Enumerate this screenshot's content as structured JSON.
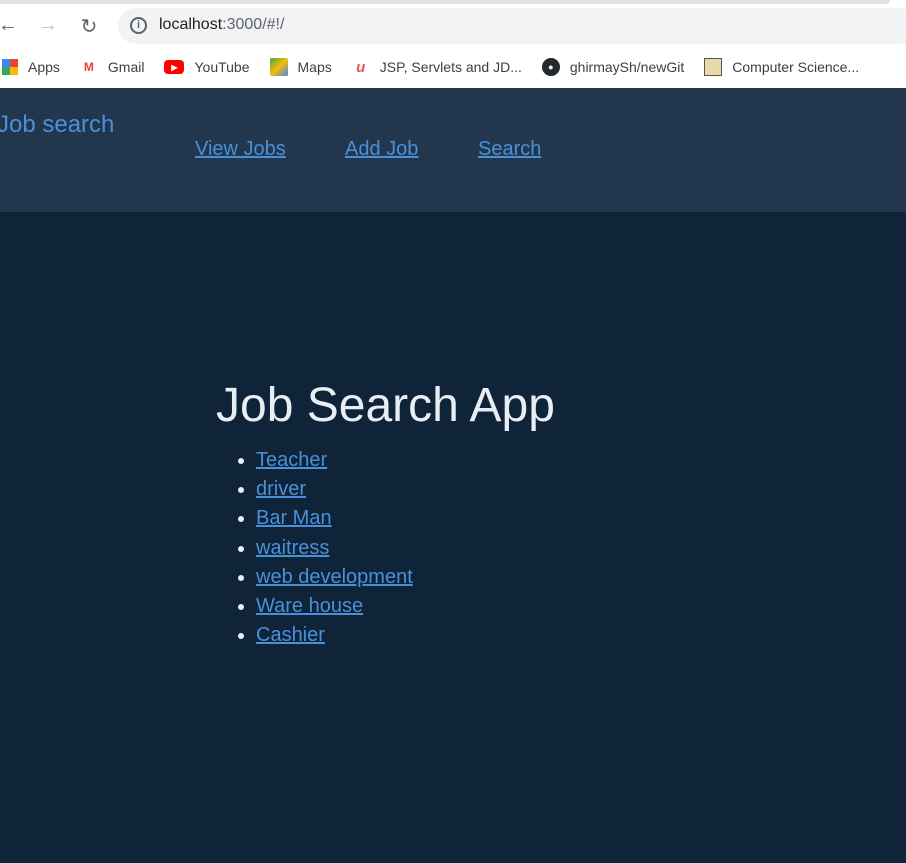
{
  "browser": {
    "url_host": "localhost",
    "url_rest": ":3000/#!/",
    "bookmarks": [
      {
        "label": "Apps",
        "icon": "apps-grid-icon"
      },
      {
        "label": "Gmail",
        "icon": "gmail-icon"
      },
      {
        "label": "YouTube",
        "icon": "youtube-icon"
      },
      {
        "label": "Maps",
        "icon": "maps-icon"
      },
      {
        "label": "JSP, Servlets and JD...",
        "icon": "udemy-icon"
      },
      {
        "label": "ghirmaySh/newGit",
        "icon": "github-icon"
      },
      {
        "label": "Computer Science...",
        "icon": "site-icon"
      }
    ]
  },
  "header": {
    "brand": "Job search",
    "nav": [
      "View Jobs",
      "Add Job",
      "Search"
    ]
  },
  "main": {
    "title": "Job Search App",
    "jobs": [
      "Teacher",
      "driver",
      "Bar Man",
      "waitress",
      "web development",
      "Ware house",
      "Cashier"
    ]
  }
}
